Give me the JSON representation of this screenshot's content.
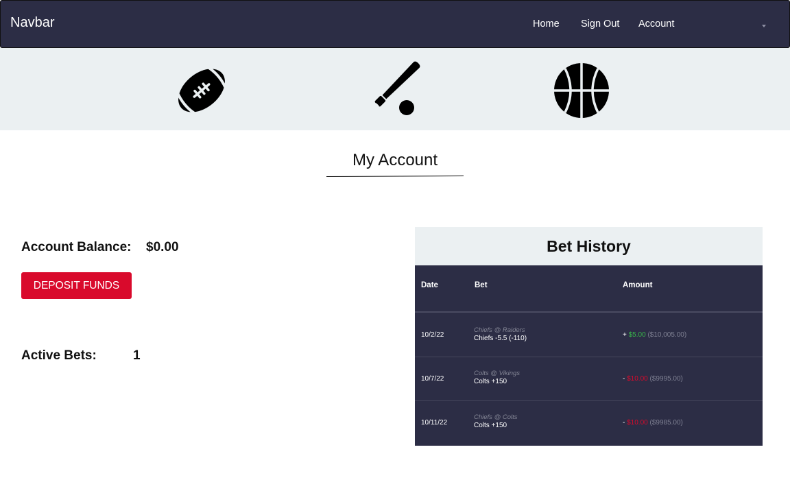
{
  "navbar": {
    "brand": "Navbar",
    "links": [
      "Home",
      "Sign Out",
      "Account"
    ]
  },
  "sports": {
    "icons": [
      "football-icon",
      "baseball-bat-icon",
      "basketball-icon"
    ]
  },
  "page": {
    "title": "My Account"
  },
  "account": {
    "balance_label": "Account Balance:",
    "balance_value": "$0.00",
    "deposit_label": "DEPOSIT FUNDS",
    "active_label": "Active Bets:",
    "active_value": "1"
  },
  "history": {
    "title": "Bet History",
    "columns": [
      "Date",
      "Bet",
      "Amount"
    ],
    "rows": [
      {
        "date": "10/2/22",
        "matchup": "Chiefs @ Raiders",
        "pick": "Chiefs -5.5 (-110)",
        "sign": "+",
        "amount": "$5.00",
        "running": "($10,005.00)"
      },
      {
        "date": "10/7/22",
        "matchup": "Colts @ Vikings",
        "pick": "Colts +150",
        "sign": "-",
        "amount": "$10.00",
        "running": "($9995.00)"
      },
      {
        "date": "10/11/22",
        "matchup": "Chiefs @ Colts",
        "pick": "Colts +150",
        "sign": "-",
        "amount": "$10.00",
        "running": "($9985.00)"
      }
    ]
  },
  "colors": {
    "navbar_bg": "#2c2d45",
    "band_bg": "#ebf0f2",
    "accent_red": "#d90a2c",
    "win_green": "#38b54a"
  }
}
